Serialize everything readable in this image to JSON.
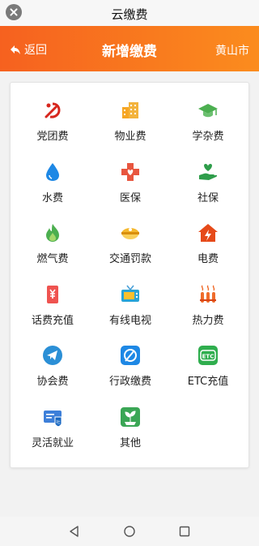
{
  "app": {
    "title": "云缴费"
  },
  "header": {
    "back_label": "返回",
    "title": "新增缴费",
    "city": "黄山市"
  },
  "colors": {
    "header_start": "#f6611f",
    "header_end": "#fb8c1e"
  },
  "items": [
    {
      "label": "党团费",
      "icon": "party-emblem-icon"
    },
    {
      "label": "物业费",
      "icon": "building-icon"
    },
    {
      "label": "学杂费",
      "icon": "graduation-cap-icon"
    },
    {
      "label": "水费",
      "icon": "water-drop-icon"
    },
    {
      "label": "医保",
      "icon": "medical-cross-icon"
    },
    {
      "label": "社保",
      "icon": "hand-heart-icon"
    },
    {
      "label": "燃气费",
      "icon": "flame-icon"
    },
    {
      "label": "交通罚款",
      "icon": "police-cap-icon"
    },
    {
      "label": "电费",
      "icon": "house-lightning-icon"
    },
    {
      "label": "话费充值",
      "icon": "phone-yen-icon"
    },
    {
      "label": "有线电视",
      "icon": "tv-icon"
    },
    {
      "label": "热力费",
      "icon": "radiator-icon"
    },
    {
      "label": "协会费",
      "icon": "paper-plane-icon"
    },
    {
      "label": "行政缴费",
      "icon": "admin-fee-icon"
    },
    {
      "label": "ETC充值",
      "icon": "etc-icon"
    },
    {
      "label": "灵活就业",
      "icon": "employment-card-icon"
    },
    {
      "label": "其他",
      "icon": "other-plant-icon"
    }
  ]
}
